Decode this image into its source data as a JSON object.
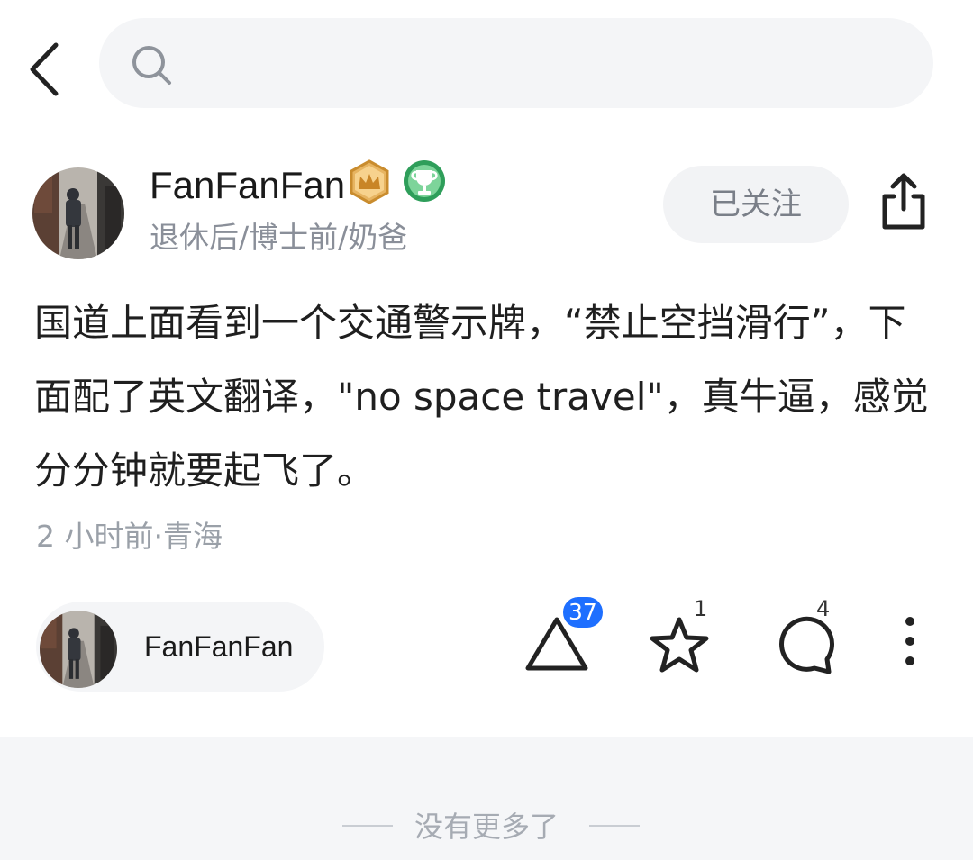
{
  "search": {
    "placeholder": "",
    "value": ""
  },
  "author": {
    "name": "FanFanFan",
    "tagline": "退休后/博士前/奶爸",
    "follow_label": "已关注"
  },
  "post": {
    "text": "国道上面看到一个交通警示牌，“禁止空挡滑行”，下面配了英文翻译，\"no space travel\"，真牛逼，感觉分分钟就要起飞了。",
    "meta": "2 小时前·青海"
  },
  "actions": {
    "author_chip_name": "FanFanFan",
    "upvote_count": "37",
    "favorite_count": "1",
    "comment_count": "4"
  },
  "footer": {
    "text": "没有更多了"
  },
  "colors": {
    "accent_blue": "#1e6fff",
    "crown_gold": "#d9a04a",
    "trophy_green": "#2e9e5a",
    "muted_text": "#8a8f99"
  },
  "icons": [
    "back-arrow-icon",
    "search-icon",
    "crown-badge-icon",
    "trophy-badge-icon",
    "share-icon",
    "upvote-triangle-icon",
    "star-icon",
    "comment-bubble-icon",
    "more-dots-icon"
  ]
}
